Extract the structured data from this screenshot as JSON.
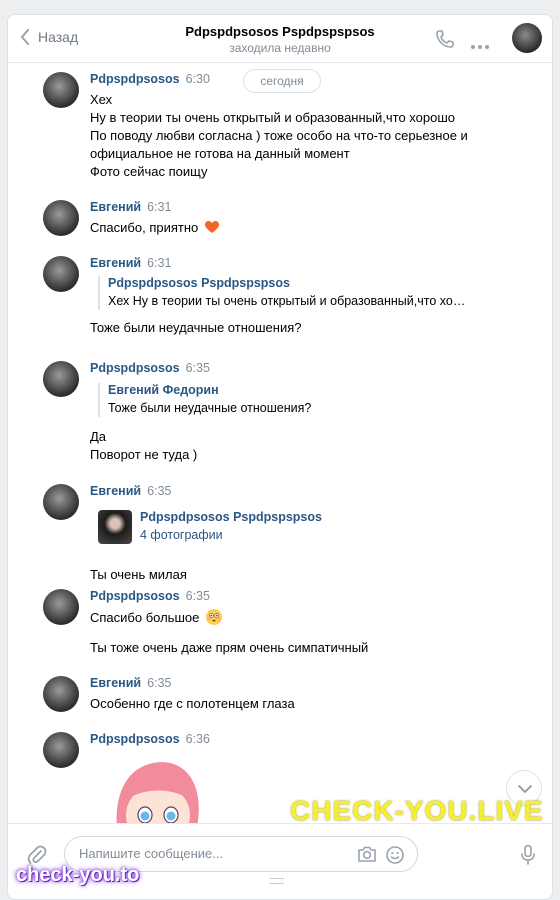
{
  "header": {
    "back_label": "Назад",
    "title": "Pdpspdpsosos Pspdpspspsos",
    "status": "заходила недавно"
  },
  "date_pill": "сегодня",
  "messages": [
    {
      "author": "Pdpspdpsosos",
      "time": "6:30",
      "lines": [
        "Хех",
        "Ну в теории ты очень открытый и образованный,что хорошо",
        "По поводу любви согласна ) тоже особо на что-то серьезное и",
        "официальное не готова на данный момент",
        "Фото сейчас поищу"
      ]
    },
    {
      "author": "Евгений",
      "time": "6:31",
      "lines": [
        "Спасибо, приятно"
      ],
      "emoji": "heart"
    },
    {
      "author": "Евгений",
      "time": "6:31",
      "quote": {
        "author": "Pdpspdpsosos Pspdpspspsos",
        "text": "Хех Ну в теории ты очень открытый и образованный,что хо…"
      },
      "lines": [
        "Тоже были неудачные отношения?"
      ]
    },
    {
      "author": "Pdpspdpsosos",
      "time": "6:35",
      "quote": {
        "author": "Евгений Федорин",
        "text": "Тоже были неудачные отношения?"
      },
      "lines": [
        "Да",
        "Поворот не туда )"
      ]
    },
    {
      "author": "Евгений",
      "time": "6:35",
      "forward": {
        "author": "Pdpspdpsosos Pspdpspspsos",
        "detail": "4 фотографии"
      },
      "lines": [
        "Ты очень милая"
      ]
    },
    {
      "author": "Pdpspdpsosos",
      "time": "6:35",
      "lines": [
        "Спасибо большое",
        "Ты тоже очень даже прям очень симпатичный"
      ],
      "emoji": "flushed-face"
    },
    {
      "author": "Евгений",
      "time": "6:35",
      "lines": [
        "Особенно где с полотенцем глаза"
      ]
    },
    {
      "author": "Pdpspdpsosos",
      "time": "6:36",
      "sticker": "anime-girl-sticker"
    }
  ],
  "composer": {
    "placeholder": "Напишите сообщение..."
  },
  "watermarks": {
    "top": "CHECK-YOU.LIVE",
    "bottom": "check-you.to"
  },
  "colors": {
    "author": "#2a5885",
    "meta": "#818c99",
    "background": "#edeef0"
  }
}
